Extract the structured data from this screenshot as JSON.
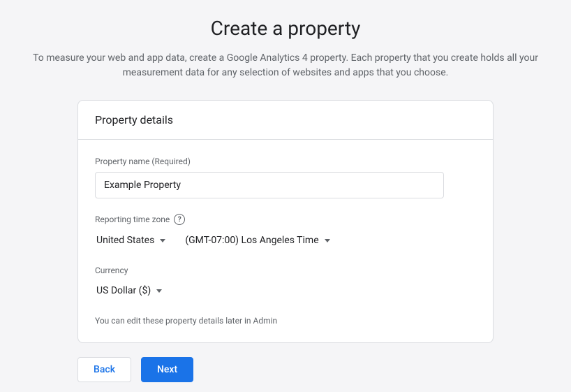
{
  "page": {
    "title": "Create a property",
    "description": "To measure your web and app data, create a Google Analytics 4 property. Each property that you create holds all your measurement data for any selection of websites and apps that you choose."
  },
  "card": {
    "header": "Property details",
    "property_name": {
      "label": "Property name (Required)",
      "value": "Example Property"
    },
    "time_zone": {
      "label": "Reporting time zone",
      "country": "United States",
      "zone": "(GMT-07:00) Los Angeles Time"
    },
    "currency": {
      "label": "Currency",
      "value": "US Dollar ($)"
    },
    "hint": "You can edit these property details later in Admin"
  },
  "actions": {
    "back": "Back",
    "next": "Next"
  }
}
